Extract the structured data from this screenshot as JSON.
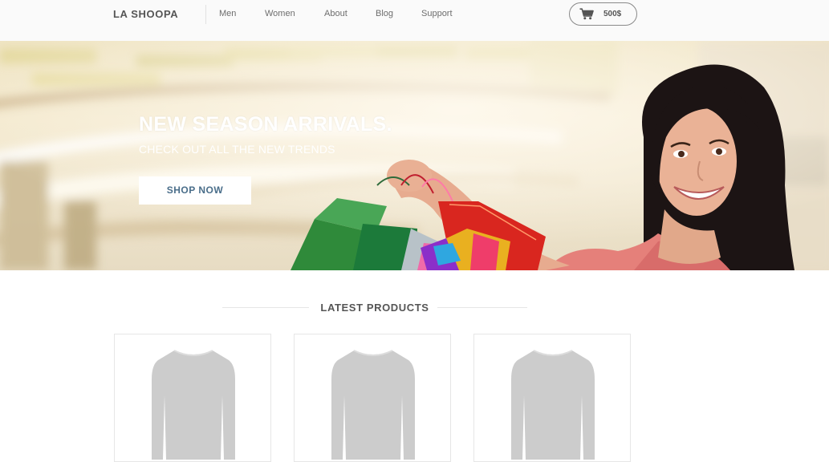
{
  "header": {
    "logo": "LA SHOOPA",
    "nav": [
      {
        "label": "Men"
      },
      {
        "label": "Women"
      },
      {
        "label": "About"
      },
      {
        "label": "Blog"
      },
      {
        "label": "Support"
      }
    ],
    "cart": {
      "total": "500$",
      "icon": "shopping-cart-icon"
    }
  },
  "hero": {
    "title": "NEW SEASON ARRIVALS.",
    "subtitle": "CHECK OUT ALL THE NEW TRENDS",
    "cta_label": "SHOP NOW"
  },
  "latest": {
    "heading": "LATEST PRODUCTS",
    "products": [
      {
        "image": "sweater-placeholder"
      },
      {
        "image": "sweater-placeholder"
      },
      {
        "image": "sweater-placeholder"
      }
    ]
  },
  "colors": {
    "text": "#555555",
    "accent": "#4a6e8a",
    "placeholder": "#cccccc"
  }
}
